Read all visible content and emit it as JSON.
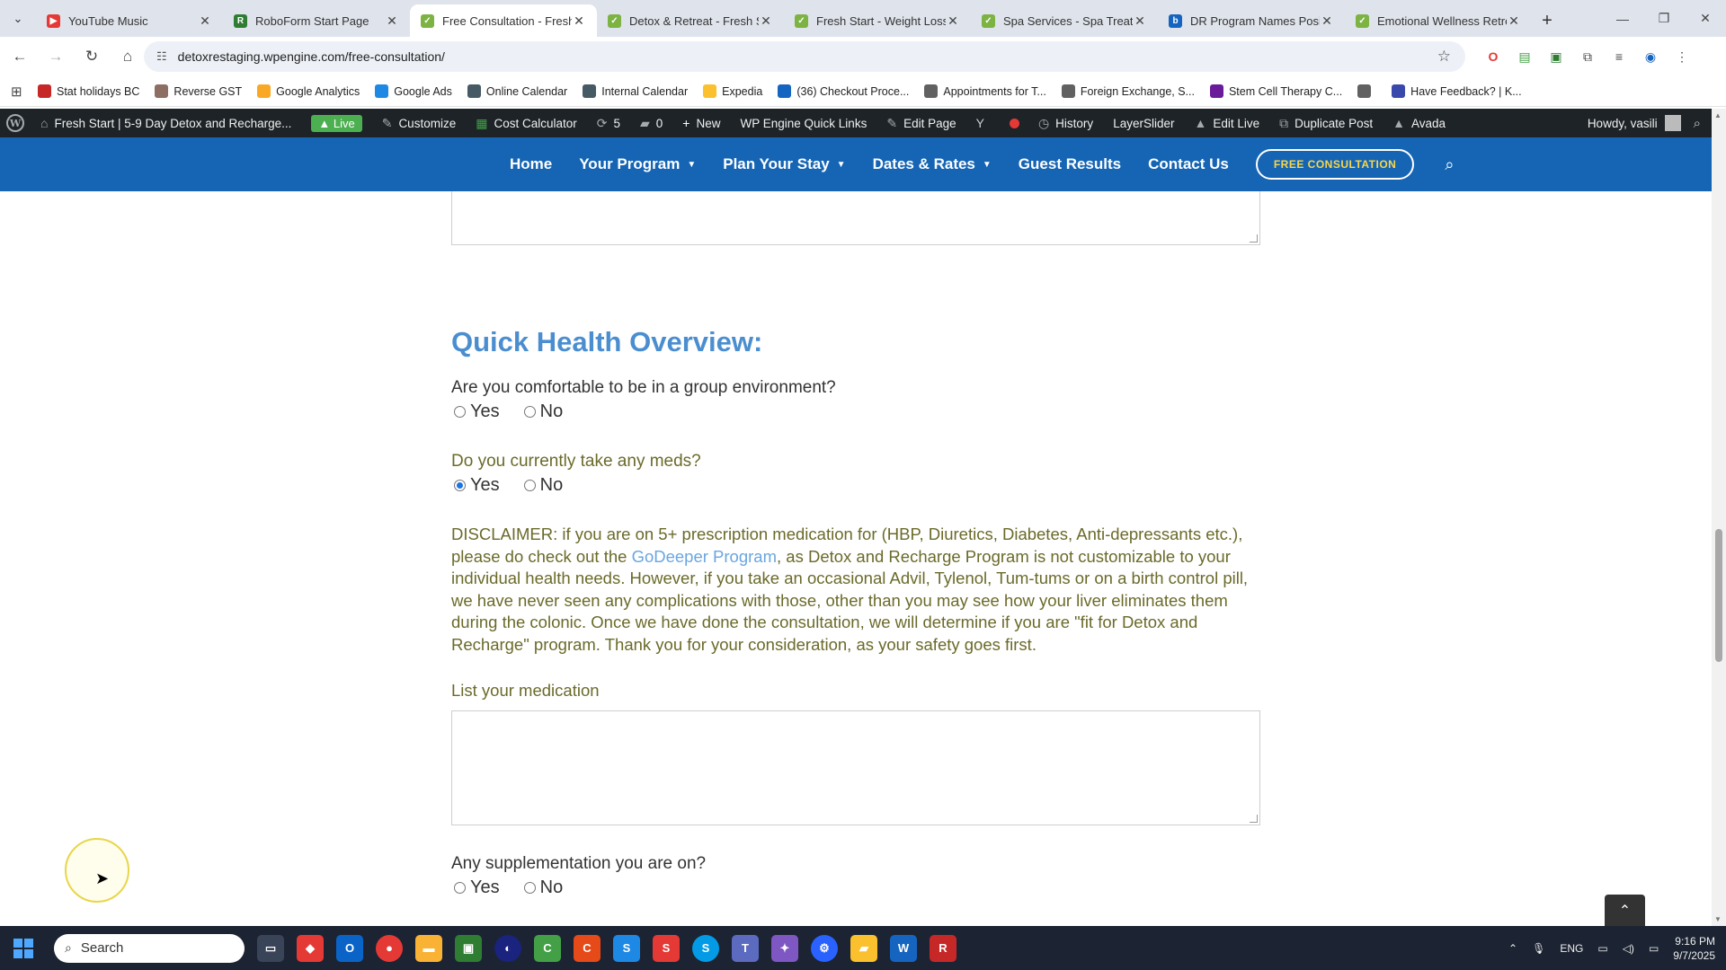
{
  "browser": {
    "tabs": [
      {
        "title": "YouTube Music",
        "color": "#e53935",
        "glyph": "▶",
        "active": false
      },
      {
        "title": "RoboForm Start Page",
        "color": "#2e7d32",
        "glyph": "R",
        "active": false
      },
      {
        "title": "Free Consultation - Fresh",
        "color": "#7cb342",
        "glyph": "✓",
        "active": true
      },
      {
        "title": "Detox & Retreat - Fresh S",
        "color": "#7cb342",
        "glyph": "✓",
        "active": false
      },
      {
        "title": "Fresh Start - Weight Loss",
        "color": "#7cb342",
        "glyph": "✓",
        "active": false
      },
      {
        "title": "Spa Services - Spa Treatm",
        "color": "#7cb342",
        "glyph": "✓",
        "active": false
      },
      {
        "title": "DR Program Names Posit",
        "color": "#1565c0",
        "glyph": "b",
        "active": false
      },
      {
        "title": "Emotional Wellness Retre",
        "color": "#7cb342",
        "glyph": "✓",
        "active": false
      }
    ],
    "url": "detoxrestaging.wpengine.com/free-consultation/",
    "bookmarks": [
      {
        "label": "Stat holidays BC",
        "color": "#c62828"
      },
      {
        "label": "Reverse GST",
        "color": "#8d6e63"
      },
      {
        "label": "Google Analytics",
        "color": "#f9a825"
      },
      {
        "label": "Google Ads",
        "color": "#1e88e5"
      },
      {
        "label": "Online Calendar",
        "color": "#455a64"
      },
      {
        "label": "Internal Calendar",
        "color": "#455a64"
      },
      {
        "label": "Expedia",
        "color": "#fbc02d"
      },
      {
        "label": "(36) Checkout Proce...",
        "color": "#1565c0"
      },
      {
        "label": "Appointments for T...",
        "color": "#616161"
      },
      {
        "label": "Foreign Exchange, S...",
        "color": "#616161"
      },
      {
        "label": "Stem Cell Therapy C...",
        "color": "#6a1b9a"
      },
      {
        "label": "",
        "color": "#616161"
      },
      {
        "label": "Have Feedback? | K...",
        "color": "#3949ab"
      }
    ]
  },
  "wpbar": {
    "site_name": "Fresh Start | 5-9 Day Detox and Recharge...",
    "live": "Live",
    "customize": "Customize",
    "cost_calculator": "Cost Calculator",
    "updates": "5",
    "comments": "0",
    "new": "New",
    "wp_engine": "WP Engine Quick Links",
    "edit_page": "Edit Page",
    "history": "History",
    "layerslider": "LayerSlider",
    "edit_live": "Edit Live",
    "duplicate": "Duplicate Post",
    "avada": "Avada",
    "howdy": "Howdy, vasili"
  },
  "sitenav": {
    "home": "Home",
    "your_program": "Your Program",
    "plan_your_stay": "Plan Your Stay",
    "dates_rates": "Dates & Rates",
    "guest_results": "Guest Results",
    "contact_us": "Contact Us",
    "free_consultation": "FREE CONSULTATION"
  },
  "form": {
    "section_title": "Quick Health Overview:",
    "q_group": "Are you comfortable to be in a group environment?",
    "q_meds": "Do you currently take any meds?",
    "yes": "Yes",
    "no": "No",
    "meds_selected": "Yes",
    "disclaimer_a": "DISCLAIMER: if you are on 5+ prescription medication for (HBP, Diuretics, Diabetes, Anti-depressants etc.), please do check out the ",
    "disclaimer_link": "GoDeeper Program",
    "disclaimer_b": ", as Detox and Recharge Program is not customizable to your individual health needs. However, if you take an occasional Advil, Tylenol, Tum-tums or on a birth control pill, we have never seen any complications with those, other than you may see how your liver eliminates them during the colonic. Once we have done the consultation, we will determine if you are \"fit for Detox and Recharge\" program. Thank you for your consideration, as your safety goes first.",
    "list_med_label": "List your medication",
    "q_supplement": "Any supplementation you are on?"
  },
  "taskbar": {
    "search_placeholder": "Search",
    "time": "9:16 PM",
    "date": "9/7/2025",
    "lang": "ENG"
  }
}
